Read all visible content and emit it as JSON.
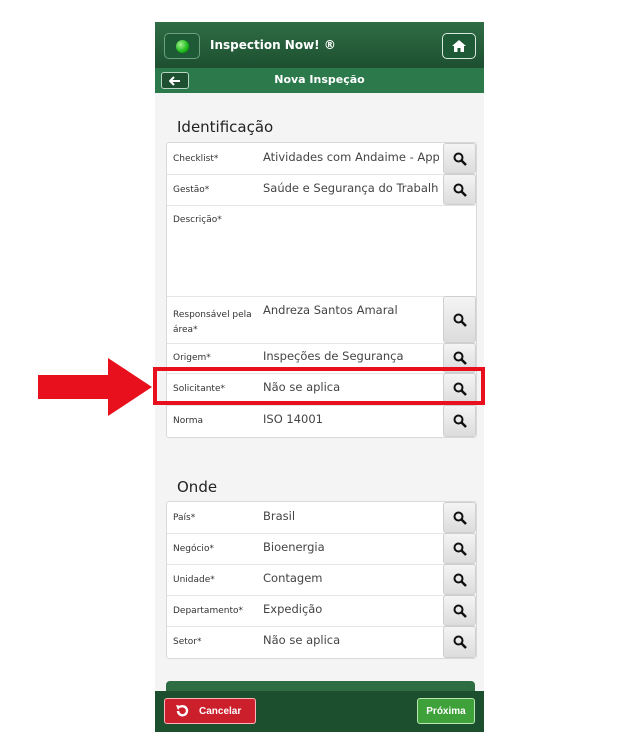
{
  "header": {
    "app_title": "Inspection Now! ®",
    "page_title": "Nova Inspeção"
  },
  "sections": {
    "identificacao": {
      "title": "Identificação",
      "fields": [
        {
          "label": "Checklist*",
          "value": "Atividades com Andaime -  App Mobile"
        },
        {
          "label": "Gestão*",
          "value": "Saúde e Segurança do Trabalho"
        },
        {
          "label": "Descrição*",
          "value": ""
        },
        {
          "label": "Responsável pela área*",
          "value": "Andreza Santos Amaral"
        },
        {
          "label": "Origem*",
          "value": "Inspeções de Segurança"
        },
        {
          "label": "Solicitante*",
          "value": "Não se aplica"
        },
        {
          "label": "Norma",
          "value": "ISO 14001"
        }
      ]
    },
    "onde": {
      "title": "Onde",
      "fields": [
        {
          "label": "País*",
          "value": "Brasil"
        },
        {
          "label": "Negócio*",
          "value": "Bioenergia"
        },
        {
          "label": "Unidade*",
          "value": "Contagem"
        },
        {
          "label": "Departamento*",
          "value": "Expedição"
        },
        {
          "label": "Setor*",
          "value": "Não se aplica"
        }
      ]
    }
  },
  "footer": {
    "cancel_label": "Cancelar",
    "next_label": "Próxima"
  },
  "colors": {
    "header_green": "#1d4f30",
    "accent_red": "#e8101c",
    "cancel_red": "#cc1f2c",
    "next_green": "#3ea13a"
  }
}
